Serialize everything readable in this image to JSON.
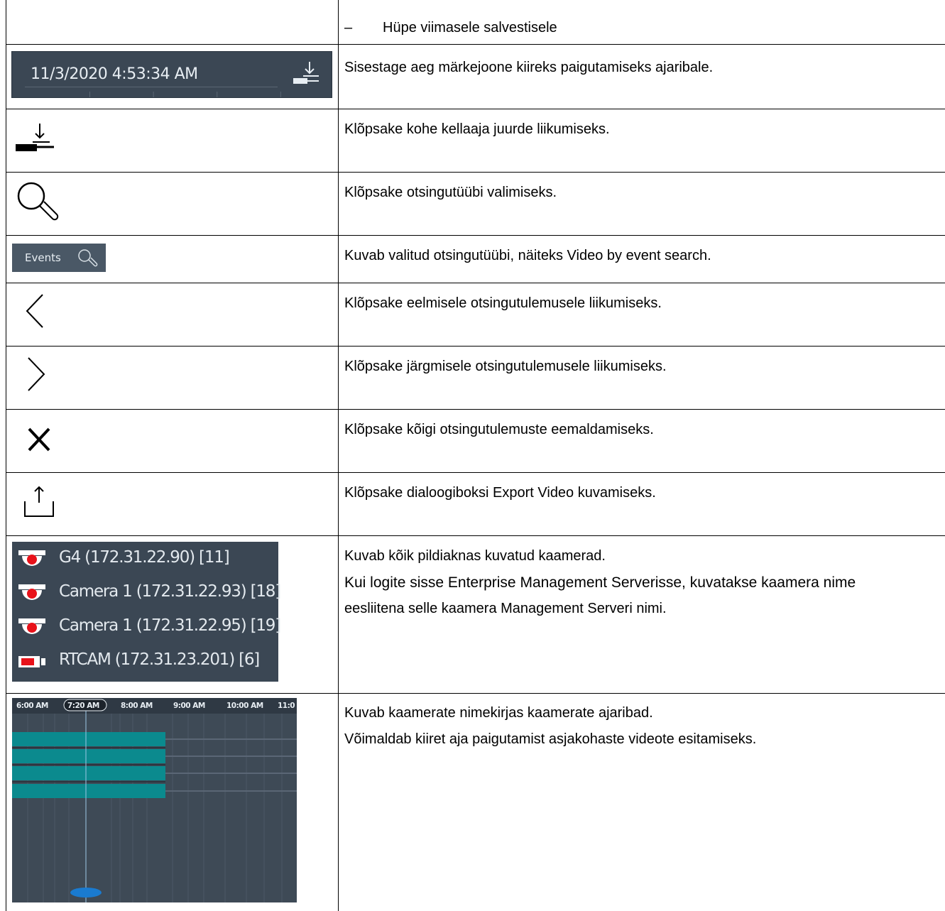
{
  "rows": {
    "r0": {
      "dash": "–",
      "text": "Hüpe viimasele salvestisele"
    },
    "r1": {
      "datetime": "11/3/2020 4:53:34 AM",
      "text": "Sisestage aeg märkejoone kiireks paigutamiseks ajaribale.",
      "icon": "download-to-time-icon"
    },
    "r2": {
      "text": "Klõpsake kohe kellaaja juurde liikumiseks.",
      "icon": "go-to-time-icon"
    },
    "r3": {
      "text": "Klõpsake otsingutüübi valimiseks.",
      "icon": "search-icon"
    },
    "r4": {
      "button_label": "Events",
      "text_before": "Kuvab valitud otsingutüübi, näiteks ",
      "text_bold": "Video by event search",
      "text_after": ".",
      "icon": "search-icon"
    },
    "r5": {
      "text": "Klõpsake eelmisele otsingutulemusele liikumiseks.",
      "icon": "chevron-left-icon"
    },
    "r6": {
      "text": "Klõpsake järgmisele otsingutulemusele liikumiseks.",
      "icon": "chevron-right-icon"
    },
    "r7": {
      "text": "Klõpsake kõigi otsingutulemuste eemaldamiseks.",
      "icon": "close-icon"
    },
    "r8": {
      "text_before": "Klõpsake dialoogiboksi ",
      "text_bold": "Export Video",
      "text_after": " kuvamiseks.",
      "icon": "export-icon"
    },
    "r9": {
      "cameras": [
        {
          "name": "G4 (172.31.22.90) [11]",
          "icon": "dome-camera-icon"
        },
        {
          "name": "Camera 1 (172.31.22.93) [18]",
          "icon": "dome-camera-icon"
        },
        {
          "name": "Camera 1 (172.31.22.95) [19]",
          "icon": "dome-camera-icon"
        },
        {
          "name": "RTCAM (172.31.23.201) [6]",
          "icon": "box-camera-icon"
        }
      ],
      "line1": "Kuvab kõik pildiaknas kuvatud kaamerad.",
      "line2": "Kui logite sisse Enterprise Management Serverisse, kuvatakse kaamera nime",
      "line3": "eesliitena selle kaamera Management Serveri nimi."
    },
    "r10": {
      "timeline": {
        "labels": [
          "6:00 AM",
          "7:20 AM",
          "8:00 AM",
          "9:00 AM",
          "10:00 AM",
          "11:0"
        ],
        "current": "7:20 AM"
      },
      "line1": "Kuvab kaamerate nimekirjas kaamerate ajaribad.",
      "line2": "Võimaldab kiiret aja paigutamist asjakohaste videote esitamiseks."
    }
  },
  "colors": {
    "panel": "#3b4754",
    "accent": "#0b8a8e",
    "record_red": "#e8121a",
    "marker_blue": "#1a7bd0"
  }
}
